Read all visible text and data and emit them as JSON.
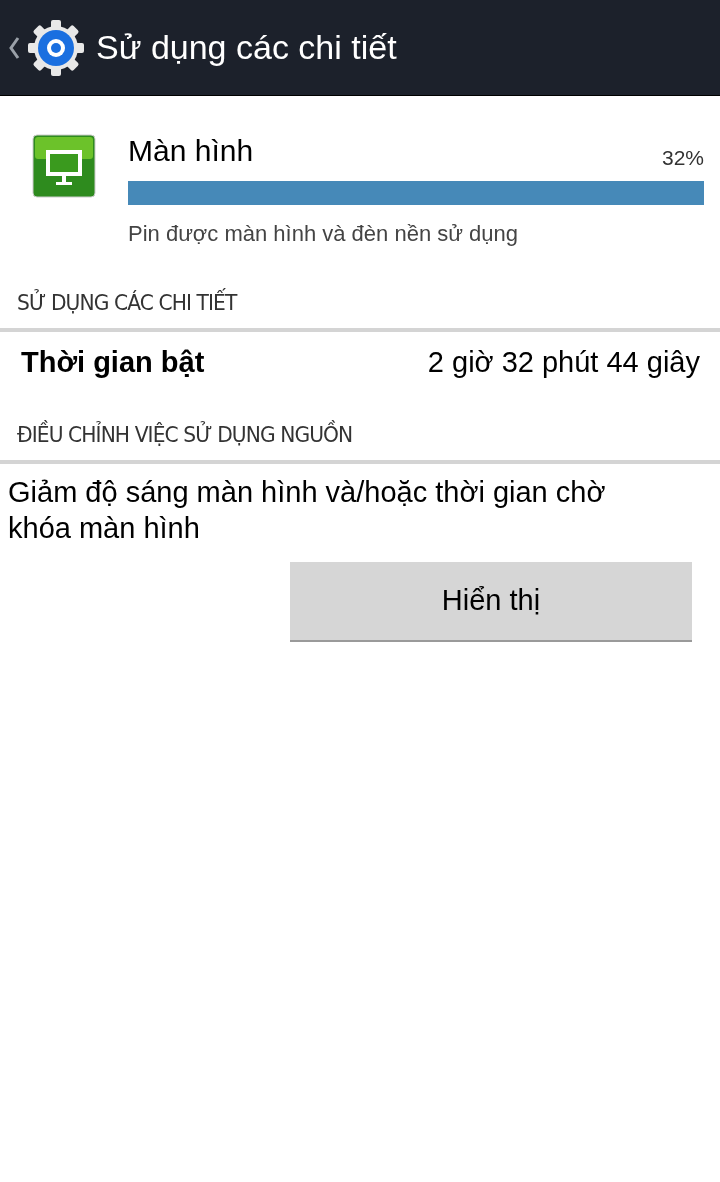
{
  "action_bar": {
    "title": "Sử dụng các chi tiết"
  },
  "usage": {
    "name": "Màn hình",
    "percent": "32%",
    "description": "Pin được màn hình và đèn nền sử dụng"
  },
  "sections": [
    {
      "header": "SỬ DỤNG CÁC CHI TIẾT",
      "kind": "detail",
      "label": "Thời gian bật",
      "value": "2 giờ 32 phút 44 giây"
    },
    {
      "header": "ĐIỀU CHỈNH VIỆC SỬ DỤNG NGUỒN",
      "kind": "action",
      "text": "Giảm độ sáng màn hình và/hoặc thời gian chờ khóa màn hình",
      "button": "Hiển thị"
    }
  ]
}
